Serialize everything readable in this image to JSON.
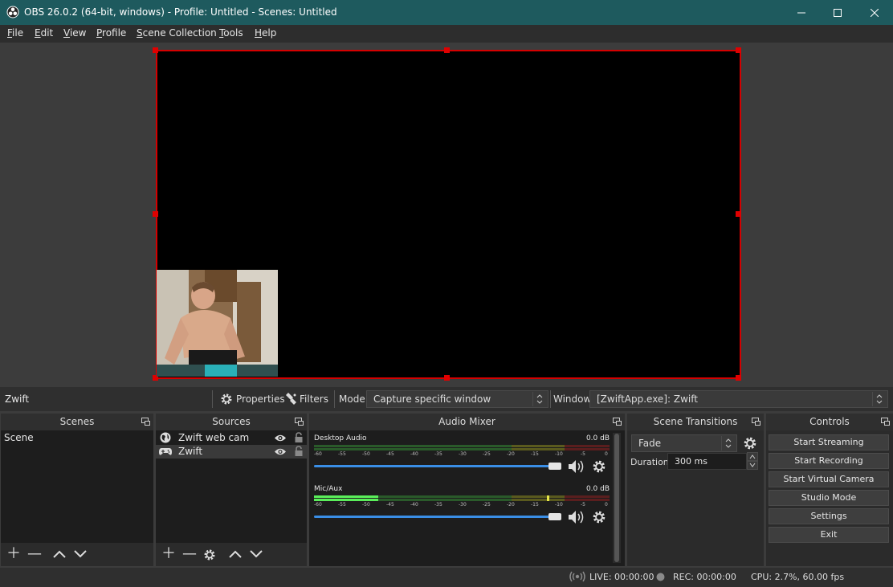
{
  "window": {
    "title": "OBS 26.0.2 (64-bit, windows) - Profile: Untitled - Scenes: Untitled"
  },
  "menu": [
    "File",
    "Edit",
    "View",
    "Profile",
    "Scene Collection",
    "Tools",
    "Help"
  ],
  "source_toolbar": {
    "source_name": "Zwift",
    "properties_label": "Properties",
    "filters_label": "Filters",
    "mode_label": "Mode",
    "mode_value": "Capture specific window",
    "window_label": "Window",
    "window_value": "[ZwiftApp.exe]: Zwift"
  },
  "scenes": {
    "title": "Scenes",
    "items": [
      "Scene"
    ]
  },
  "sources": {
    "title": "Sources",
    "items": [
      {
        "name": "Zwift web cam",
        "icon": "globe-icon"
      },
      {
        "name": "Zwift",
        "icon": "gamepad-icon"
      }
    ]
  },
  "mixer": {
    "title": "Audio Mixer",
    "channels": [
      {
        "name": "Desktop Audio",
        "db": "0.0 dB",
        "level": 0
      },
      {
        "name": "Mic/Aux",
        "db": "0.0 dB",
        "level": 0.22
      }
    ],
    "ticks": [
      "-60",
      "-55",
      "-50",
      "-45",
      "-40",
      "-35",
      "-30",
      "-25",
      "-20",
      "-15",
      "-10",
      "-5",
      "0"
    ]
  },
  "transitions": {
    "title": "Scene Transitions",
    "value": "Fade",
    "duration_label": "Duration",
    "duration_value": "300 ms"
  },
  "controls": {
    "title": "Controls",
    "buttons": [
      "Start Streaming",
      "Start Recording",
      "Start Virtual Camera",
      "Studio Mode",
      "Settings",
      "Exit"
    ]
  },
  "status": {
    "live": "LIVE: 00:00:00",
    "rec": "REC: 00:00:00",
    "cpu": "CPU: 2.7%, 60.00 fps"
  },
  "colors": {
    "titlebar": "#1e5a5e",
    "selection": "#d40000",
    "meter_green": "#3bb03b",
    "meter_yellow": "#c8c800",
    "meter_red": "#c83232",
    "slider_blue": "#3a8ee6"
  }
}
